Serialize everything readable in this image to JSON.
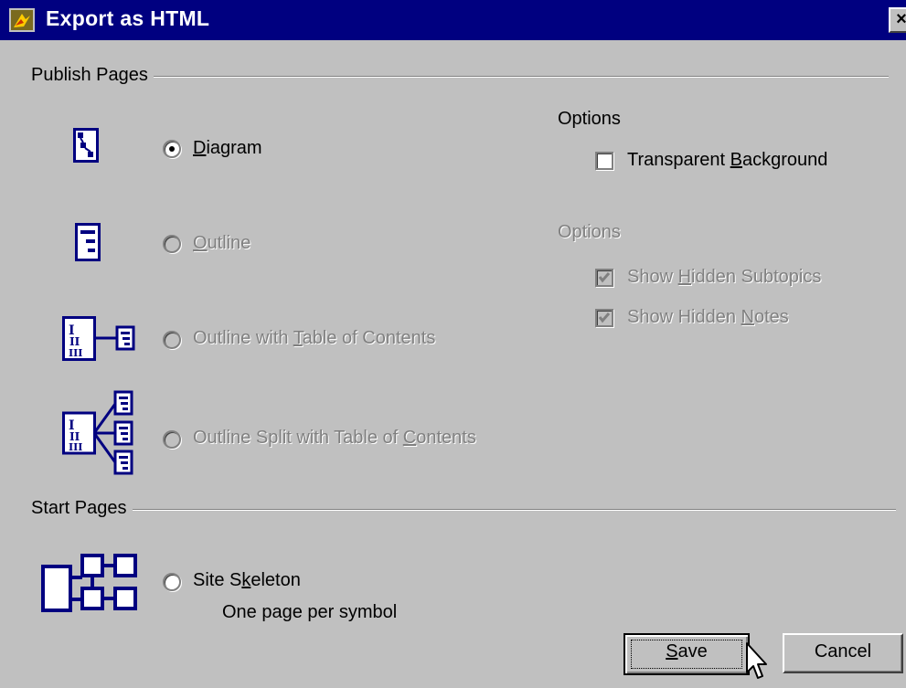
{
  "window": {
    "title": "Export as HTML"
  },
  "publish_pages": {
    "label": "Publish Pages",
    "options": [
      {
        "pre": "",
        "u": "D",
        "post": "iagram",
        "selected": true,
        "enabled": true
      },
      {
        "pre": "",
        "u": "O",
        "post": "utline",
        "selected": false,
        "enabled": false
      },
      {
        "pre": "Outline with ",
        "u": "T",
        "post": "able of Contents",
        "selected": false,
        "enabled": false
      },
      {
        "pre": "Outline Split with Table of ",
        "u": "C",
        "post": "ontents",
        "selected": false,
        "enabled": false
      }
    ]
  },
  "diagram_options": {
    "label": "Options",
    "transparent": {
      "pre": "Transparent ",
      "u": "B",
      "post": "ackground",
      "checked": false
    }
  },
  "outline_options": {
    "label": "Options",
    "hidden_subtopics": {
      "pre": "Show ",
      "u": "H",
      "post": "idden Subtopics",
      "checked": true
    },
    "hidden_notes": {
      "pre": "Show Hidden ",
      "u": "N",
      "post": "otes",
      "checked": true
    }
  },
  "start_pages": {
    "label": "Start Pages",
    "site_skeleton": {
      "pre": "Site S",
      "u": "k",
      "post": "eleton",
      "selected": false
    },
    "description": "One page per symbol"
  },
  "buttons": {
    "save": {
      "pre": "",
      "u": "S",
      "post": "ave"
    },
    "cancel": "Cancel"
  },
  "colors": {
    "titlebar": "#000080",
    "face": "#c0c0c0",
    "icon_blue": "#000080",
    "disabled_text": "#808080"
  }
}
